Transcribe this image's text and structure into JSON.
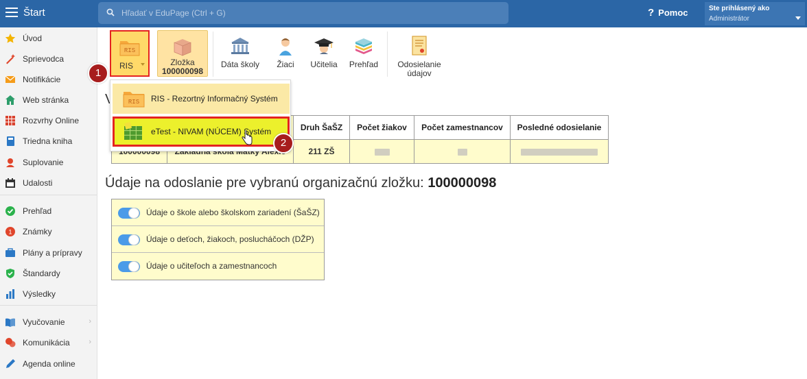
{
  "app": {
    "title": "Štart"
  },
  "search": {
    "placeholder": "Hľadať v EduPage (Ctrl + G)"
  },
  "help": {
    "label": "Pomoc",
    "glyph": "?"
  },
  "user": {
    "line1": "Ste prihlásený ako",
    "line2": "Administrátor"
  },
  "sidebar": {
    "items": [
      {
        "label": "Úvod",
        "icon": "star-icon",
        "color": "#f4b400"
      },
      {
        "label": "Sprievodca",
        "icon": "magic-wand-icon",
        "color": "#e0452b"
      },
      {
        "label": "Notifikácie",
        "icon": "envelope-icon",
        "color": "#f59c1a"
      },
      {
        "label": "Web stránka",
        "icon": "house-icon",
        "color": "#2e9e6b"
      },
      {
        "label": "Rozvrhy Online",
        "icon": "timetable-icon",
        "color": "#d9432f"
      },
      {
        "label": "Triedna kniha",
        "icon": "book-icon",
        "color": "#2b78c5"
      },
      {
        "label": "Suplovanie",
        "icon": "substitution-icon",
        "color": "#e0452b"
      },
      {
        "label": "Udalosti",
        "icon": "calendar-icon",
        "color": "#333333"
      },
      {
        "label": "Prehľad",
        "icon": "check-circle-icon",
        "color": "#2bb24c"
      },
      {
        "label": "Známky",
        "icon": "grades-icon",
        "color": "#e0452b"
      },
      {
        "label": "Plány a prípravy",
        "icon": "briefcase-icon",
        "color": "#2b78c5"
      },
      {
        "label": "Štandardy",
        "icon": "shield-check-icon",
        "color": "#2bb24c"
      },
      {
        "label": "Výsledky",
        "icon": "bar-chart-icon",
        "color": "#2b78c5"
      },
      {
        "label": "Vyučovanie",
        "icon": "open-book-icon",
        "color": "#2b78c5"
      },
      {
        "label": "Komunikácia",
        "icon": "chat-bubbles-icon",
        "color": "#e0452b"
      },
      {
        "label": "Agenda online",
        "icon": "pen-icon",
        "color": "#2b78c5"
      }
    ],
    "chevron": "›"
  },
  "toolbar": {
    "ris_label": "RIS",
    "ris_icon_text": "RIS",
    "zlozka_label": "Zložka",
    "zlozka_value": "100000098",
    "data_skoly": "Dáta školy",
    "ziaci": "Žiaci",
    "ucitelia": "Učitelia",
    "prehlad": "Prehľad",
    "odosielanie_line1": "Odosielanie",
    "odosielanie_line2": "údajov"
  },
  "dropdown": {
    "item1": "RIS - Rezortný Informačný Systém",
    "item1_icon_text": "RIS",
    "item2": "eTest - NIVAM (NÚCEM) Systém"
  },
  "badges": {
    "one": "1",
    "two": "2"
  },
  "content": {
    "heading_partial": "V",
    "table": {
      "headers": [
        "Druh ŠaŠZ",
        "Počet žiakov",
        "Počet zamestnancov",
        "Posledné odosielanie"
      ],
      "row": {
        "id": "100000098",
        "name": "Základná škola Matky Alexie",
        "druh": "211 ZŠ"
      }
    },
    "section_title_prefix": "Údaje na odoslanie pre vybranú organizačnú zložku:",
    "section_title_value": "100000098",
    "toggles": [
      {
        "label": "Údaje o škole alebo školskom zariadení (ŠaŠZ)",
        "on": true
      },
      {
        "label": "Údaje o deťoch, žiakoch, poslucháčoch (DŽP)",
        "on": true
      },
      {
        "label": "Údaje o učiteľoch a zamestnancoch",
        "on": true
      }
    ]
  },
  "colors": {
    "topbar": "#2b66a6",
    "ris_highlight": "#ffd969",
    "marker_red": "#e42321",
    "etest_highlight": "#ecf02c",
    "badge": "#a71d1d",
    "table_fill": "#fffccc",
    "toggle_on": "#4b9be8"
  }
}
